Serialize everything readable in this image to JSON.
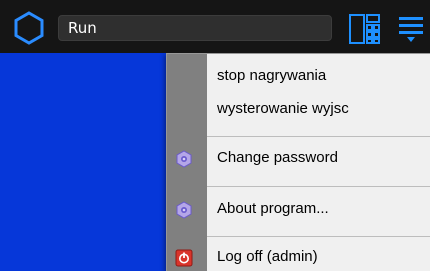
{
  "topbar": {
    "run_field": {
      "value": "Run"
    }
  },
  "menu": {
    "items": [
      {
        "label": "stop nagrywania",
        "icon": null
      },
      {
        "label": "wysterowanie wyjsc",
        "icon": null
      },
      {
        "label": "Change password",
        "icon": "gear-icon"
      },
      {
        "label": "About program...",
        "icon": "gear-icon"
      },
      {
        "label": "Log off (admin)",
        "icon": "power-icon"
      }
    ]
  },
  "colors": {
    "topbar": "#151515",
    "accent_blue": "#1e90ff",
    "workspace_blue": "#0637d9",
    "menu_background": "#f0f0f0",
    "menu_gutter": "#808080",
    "logoff_red": "#d9342b"
  }
}
